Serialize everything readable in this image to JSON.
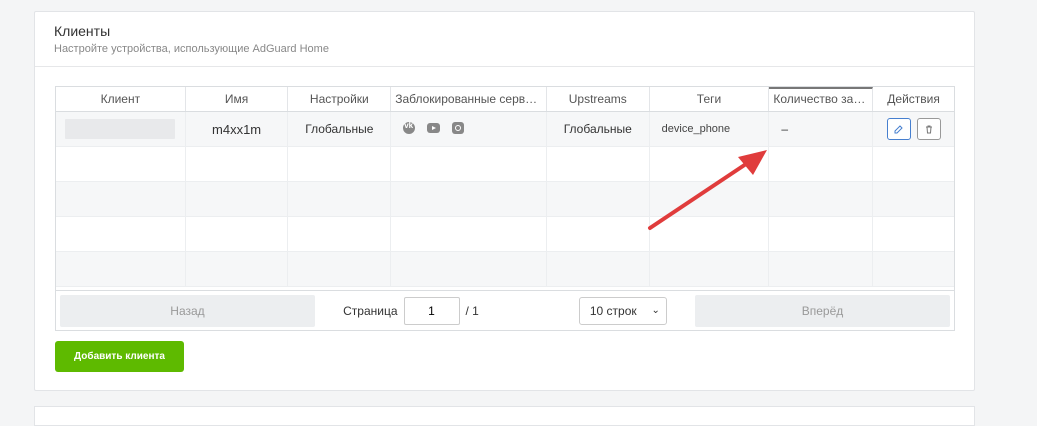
{
  "card": {
    "title": "Клиенты",
    "subtitle": "Настройте устройства, использующие AdGuard Home"
  },
  "table": {
    "columns": [
      "Клиент",
      "Имя",
      "Настройки",
      "Заблокированные сервисы",
      "Upstreams",
      "Теги",
      "Количество запросов",
      "Действия"
    ],
    "rows": [
      {
        "client": "",
        "name": "m4xx1m",
        "settings": "Глобальные",
        "blocked_services": [
          "vk-icon",
          "youtube-icon",
          "instagram-icon"
        ],
        "upstreams": "Глобальные",
        "tags": "device_phone",
        "requests": "–"
      }
    ]
  },
  "pagination": {
    "prev": "Назад",
    "page_label": "Страница",
    "page_value": "1",
    "total": "/ 1",
    "rows_select": "10 строк",
    "next": "Вперёд"
  },
  "actions": {
    "add_client": "Добавить клиента"
  },
  "colors": {
    "accent_green": "#5eba00",
    "edit_blue": "#467fcf",
    "arrow_red": "#e03c3c"
  }
}
